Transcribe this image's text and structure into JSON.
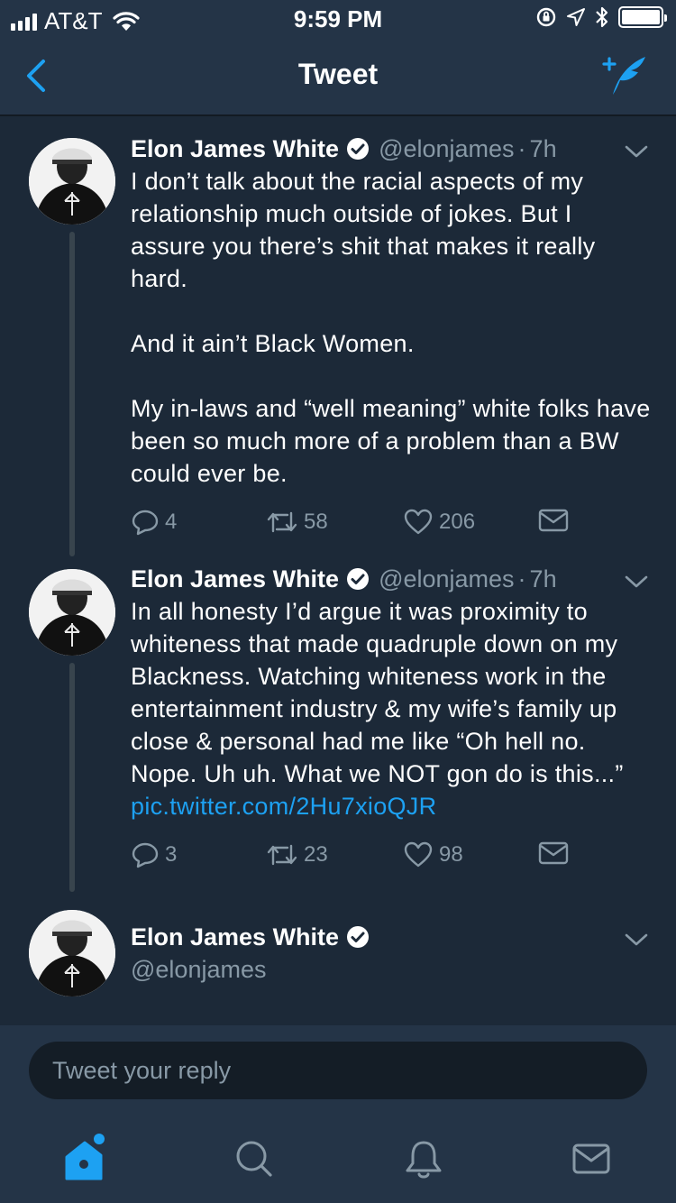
{
  "status_bar": {
    "carrier": "AT&T",
    "time": "9:59 PM",
    "battery_level": 1.0
  },
  "nav": {
    "title": "Tweet",
    "back_icon": "chevron-left-icon",
    "compose_icon": "compose-tweet-icon"
  },
  "colors": {
    "accent": "#1da1f2",
    "background": "#1c2938",
    "bar": "#243447",
    "muted": "#8899a6"
  },
  "tweets": [
    {
      "name": "Elon James White",
      "handle": "@elonjames",
      "dot": "·",
      "time": "7h",
      "text": "I don’t talk about the racial aspects of my relationship much outside of jokes. But I assure you there’s shit that makes it really hard.\n\nAnd it ain’t Black Women.\n\nMy in-laws and “well meaning” white folks have been so much more of a problem than a BW could ever be.",
      "replies": "4",
      "retweets": "58",
      "likes": "206"
    },
    {
      "name": "Elon James White",
      "handle": "@elonjames",
      "dot": "·",
      "time": "7h",
      "text": "In all honesty I’d argue it was proximity to whiteness that made quadruple down on my Blackness. Watching whiteness work in the entertainment industry & my wife’s family up close & personal had me like “Oh hell no. Nope. Uh uh. What we NOT gon do is this...” ",
      "link": "pic.twitter.com/2Hu7xioQJR",
      "replies": "3",
      "retweets": "23",
      "likes": "98"
    }
  ],
  "author_card": {
    "name": "Elon James White",
    "handle": "@elonjames"
  },
  "reply": {
    "placeholder": "Tweet your reply"
  },
  "tabs": [
    "home-icon",
    "search-icon",
    "notifications-icon",
    "messages-icon"
  ]
}
